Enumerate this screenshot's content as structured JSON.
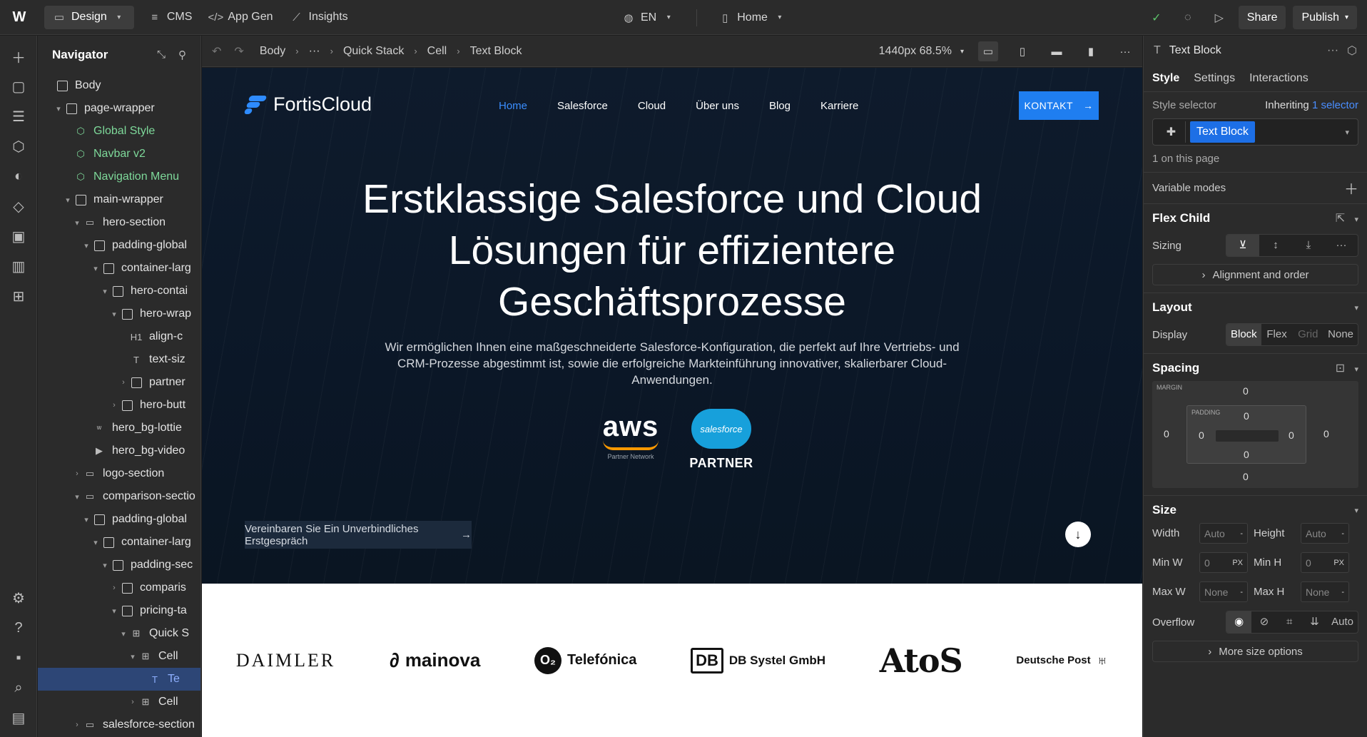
{
  "topbar": {
    "logo": "W",
    "design": "Design",
    "cms": "CMS",
    "appgen": "App Gen",
    "insights": "Insights",
    "lang": "EN",
    "page": "Home",
    "share": "Share",
    "publish": "Publish"
  },
  "navigator": {
    "title": "Navigator",
    "items": [
      {
        "label": "Body",
        "depth": 0,
        "caret": "",
        "icon": "box",
        "kind": "el"
      },
      {
        "label": "page-wrapper",
        "depth": 1,
        "caret": "▾",
        "icon": "box",
        "kind": "el"
      },
      {
        "label": "Global Style",
        "depth": 2,
        "caret": "",
        "icon": "component",
        "kind": "sym"
      },
      {
        "label": "Navbar v2",
        "depth": 2,
        "caret": "",
        "icon": "component",
        "kind": "sym"
      },
      {
        "label": "Navigation Menu",
        "depth": 2,
        "caret": "",
        "icon": "component",
        "kind": "sym"
      },
      {
        "label": "main-wrapper",
        "depth": 2,
        "caret": "▾",
        "icon": "box",
        "kind": "el"
      },
      {
        "label": "hero-section",
        "depth": 3,
        "caret": "▾",
        "icon": "section",
        "kind": "el"
      },
      {
        "label": "padding-global",
        "depth": 4,
        "caret": "▾",
        "icon": "box",
        "kind": "el"
      },
      {
        "label": "container-larg",
        "depth": 5,
        "caret": "▾",
        "icon": "box",
        "kind": "el"
      },
      {
        "label": "hero-contai",
        "depth": 6,
        "caret": "▾",
        "icon": "box",
        "kind": "el"
      },
      {
        "label": "hero-wrap",
        "depth": 7,
        "caret": "▾",
        "icon": "box",
        "kind": "el"
      },
      {
        "label": "align-c",
        "depth": 8,
        "caret": "",
        "icon": "H1",
        "kind": "el"
      },
      {
        "label": "text-siz",
        "depth": 8,
        "caret": "",
        "icon": "T",
        "kind": "el"
      },
      {
        "label": "partner",
        "depth": 8,
        "caret": "›",
        "icon": "box",
        "kind": "el"
      },
      {
        "label": "hero-butt",
        "depth": 7,
        "caret": "›",
        "icon": "box",
        "kind": "el"
      },
      {
        "label": "hero_bg-lottie",
        "depth": 4,
        "caret": "",
        "icon": "lottie",
        "kind": "el"
      },
      {
        "label": "hero_bg-video",
        "depth": 4,
        "caret": "",
        "icon": "video",
        "kind": "el"
      },
      {
        "label": "logo-section",
        "depth": 3,
        "caret": "›",
        "icon": "section",
        "kind": "el"
      },
      {
        "label": "comparison-sectio",
        "depth": 3,
        "caret": "▾",
        "icon": "section",
        "kind": "el"
      },
      {
        "label": "padding-global",
        "depth": 4,
        "caret": "▾",
        "icon": "box",
        "kind": "el"
      },
      {
        "label": "container-larg",
        "depth": 5,
        "caret": "▾",
        "icon": "box",
        "kind": "el"
      },
      {
        "label": "padding-sec",
        "depth": 6,
        "caret": "▾",
        "icon": "box",
        "kind": "el"
      },
      {
        "label": "comparis",
        "depth": 7,
        "caret": "›",
        "icon": "box",
        "kind": "el"
      },
      {
        "label": "pricing-ta",
        "depth": 7,
        "caret": "▾",
        "icon": "box",
        "kind": "el"
      },
      {
        "label": "Quick S",
        "depth": 8,
        "caret": "▾",
        "icon": "grid",
        "kind": "el"
      },
      {
        "label": "Cell",
        "depth": 9,
        "caret": "▾",
        "icon": "grid",
        "kind": "el"
      },
      {
        "label": "Te",
        "depth": 10,
        "caret": "",
        "icon": "T",
        "kind": "selected"
      },
      {
        "label": "Cell",
        "depth": 9,
        "caret": "›",
        "icon": "grid",
        "kind": "el"
      },
      {
        "label": "salesforce-section",
        "depth": 3,
        "caret": "›",
        "icon": "section",
        "kind": "el"
      }
    ]
  },
  "canvas_toolbar": {
    "breadcrumb": [
      "Body",
      "···",
      "Quick Stack",
      "Cell",
      "Text Block"
    ],
    "viewport": "1440px 68.5%"
  },
  "site": {
    "brand": "FortisCloud",
    "nav": [
      "Home",
      "Salesforce",
      "Cloud",
      "Über uns",
      "Blog",
      "Karriere"
    ],
    "kontakt": "KONTAKT",
    "headline": "Erstklassige Salesforce und Cloud Lösungen für effizientere Geschäftsprozesse",
    "subtext": "Wir ermöglichen Ihnen eine maßgeschneiderte Salesforce-Konfiguration, die perfekt auf Ihre Vertriebs- und CRM-Prozesse abgestimmt ist, sowie die erfolgreiche Markteinführung innovativer, skalierbarer Cloud-Anwendungen.",
    "aws": "aws",
    "aws_sub": "Partner Network",
    "sf_cloud": "salesforce",
    "sf_partner": "PARTNER",
    "cta": "Vereinbaren Sie Ein Unverbindliches Erstgespräch",
    "logos": {
      "daimler": "DAIMLER",
      "mainova": "mainova",
      "telefonica_mark": "O₂",
      "telefonica": "Telefónica",
      "db_mark": "DB",
      "db": "DB Systel GmbH",
      "atos": "AtoS",
      "dp": "Deutsche Post"
    }
  },
  "panel": {
    "element": "Text Block",
    "tabs": [
      "Style",
      "Settings",
      "Interactions"
    ],
    "style_selector": "Style selector",
    "inheriting": "Inheriting",
    "inheriting_count": "1 selector",
    "selector_tag": "Text Block",
    "on_page": "1 on this page",
    "variable_modes": "Variable modes",
    "flex_child": "Flex Child",
    "sizing": "Sizing",
    "alignment": "Alignment and order",
    "layout": "Layout",
    "display": "Display",
    "display_opts": [
      "Block",
      "Flex",
      "Grid",
      "None"
    ],
    "spacing": "Spacing",
    "margin_label": "MARGIN",
    "padding_label": "PADDING",
    "margin": {
      "top": "0",
      "right": "0",
      "bottom": "0",
      "left": "0"
    },
    "padding": {
      "top": "0",
      "right": "0",
      "bottom": "0",
      "left": "0"
    },
    "size": "Size",
    "width": "Width",
    "height": "Height",
    "min_w": "Min W",
    "min_h": "Min H",
    "max_w": "Max W",
    "max_h": "Max H",
    "auto": "Auto",
    "none": "None",
    "zero": "0",
    "px": "PX",
    "dash": "-",
    "overflow": "Overflow",
    "overflow_auto": "Auto",
    "more_size": "More size options"
  },
  "colors": {
    "accent": "#1d6fe6",
    "symbol": "#7ed99a",
    "hero_bg": "#0b1727"
  }
}
